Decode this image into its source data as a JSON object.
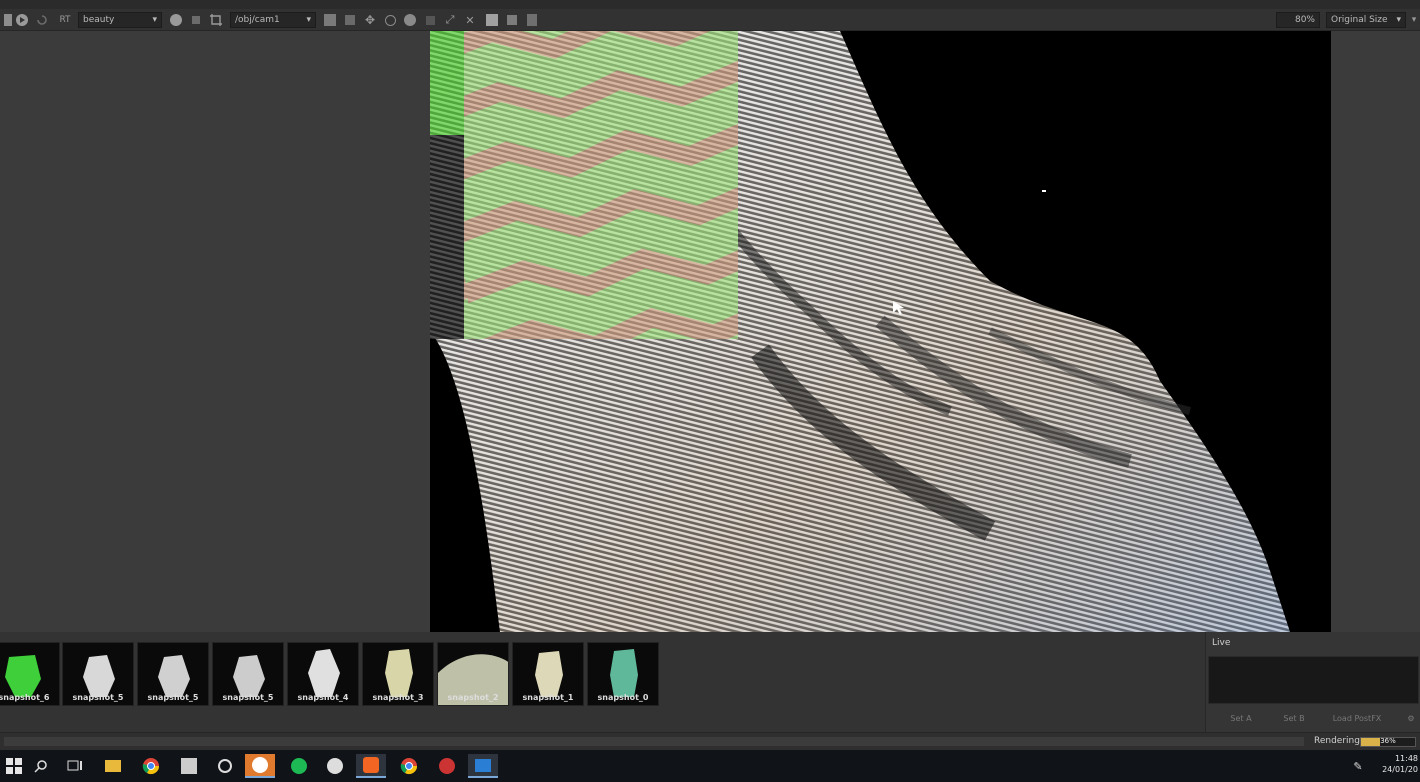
{
  "menubar": {
    "text": ""
  },
  "toolbar": {
    "rt_label": "RT",
    "aov_combo": "beauty",
    "camera_combo": "/obj/cam1",
    "zoom": "80%",
    "size_mode": "Original Size"
  },
  "snapshots": [
    {
      "label": "snapshot_6",
      "color": "#3ecf3a"
    },
    {
      "label": "snapshot_5",
      "color": "#d8d8d8"
    },
    {
      "label": "snapshot_5",
      "color": "#d0d0d0"
    },
    {
      "label": "snapshot_5",
      "color": "#cccccc"
    },
    {
      "label": "snapshot_4",
      "color": "#e0e0e0"
    },
    {
      "label": "snapshot_3",
      "color": "#d8d6a8"
    },
    {
      "label": "snapshot_2",
      "color": "#bfc0a8"
    },
    {
      "label": "snapshot_1",
      "color": "#ddd8b8"
    },
    {
      "label": "snapshot_0",
      "color": "#5fb89a"
    }
  ],
  "live": {
    "title": "Live",
    "set_a": "Set A",
    "set_b": "Set B",
    "load_post": "Load PostFX"
  },
  "status": {
    "label": "Rendering",
    "progress": 0.36,
    "progress_text": "36%"
  },
  "clock": {
    "time": "11:48",
    "date": "24/01/20"
  },
  "colors": {
    "accent": "#d9b24a",
    "viewport_bg": "#000000"
  }
}
